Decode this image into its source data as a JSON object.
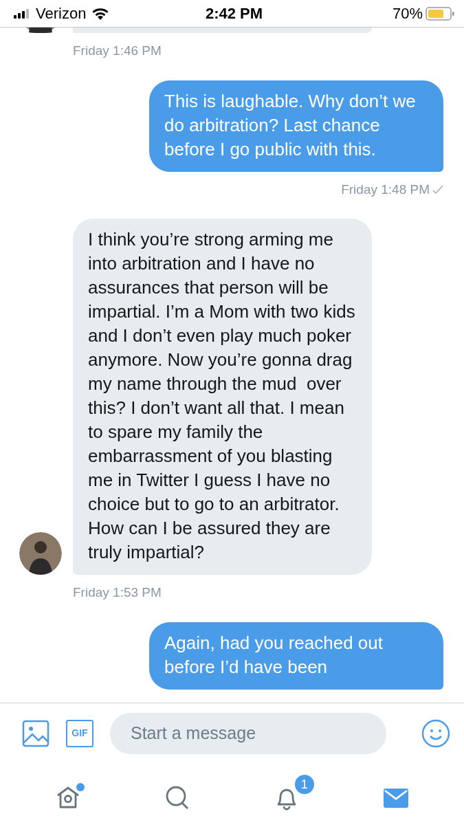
{
  "status_bar": {
    "carrier": "Verizon",
    "time": "2:42 PM",
    "battery": "70%"
  },
  "messages": [
    {
      "kind": "incoming",
      "cut_top": true,
      "avatar": true,
      "time": "Friday 1:46 PM"
    },
    {
      "kind": "outgoing",
      "text": "This is laughable. Why don’t we do arbitration? Last chance before I go public with this.",
      "time": "Friday 1:48 PM",
      "sent": true
    },
    {
      "kind": "incoming",
      "avatar": true,
      "text": "I think you’re strong arming me into arbitration and I have no assurances that person will be impartial. I’m a Mom with two kids and I don’t even play much poker anymore. Now you’re gonna drag my name through the mud  over this? I don’t want all that. I mean to spare my family the embarrassment of you blasting me in Twitter I guess I have no choice but to go to an arbitrator. How can I be assured they are truly impartial?",
      "time": "Friday 1:53 PM"
    },
    {
      "kind": "outgoing",
      "text": "Again, had you reached out before I’d have been"
    }
  ],
  "composer": {
    "placeholder": "Start a message",
    "gif_label": "GIF"
  },
  "tabs": [
    {
      "kind": "home",
      "selected": false,
      "new_dot": true
    },
    {
      "kind": "search",
      "selected": false
    },
    {
      "kind": "notifications",
      "selected": false,
      "badge": "1"
    },
    {
      "kind": "messages",
      "selected": true
    }
  ]
}
